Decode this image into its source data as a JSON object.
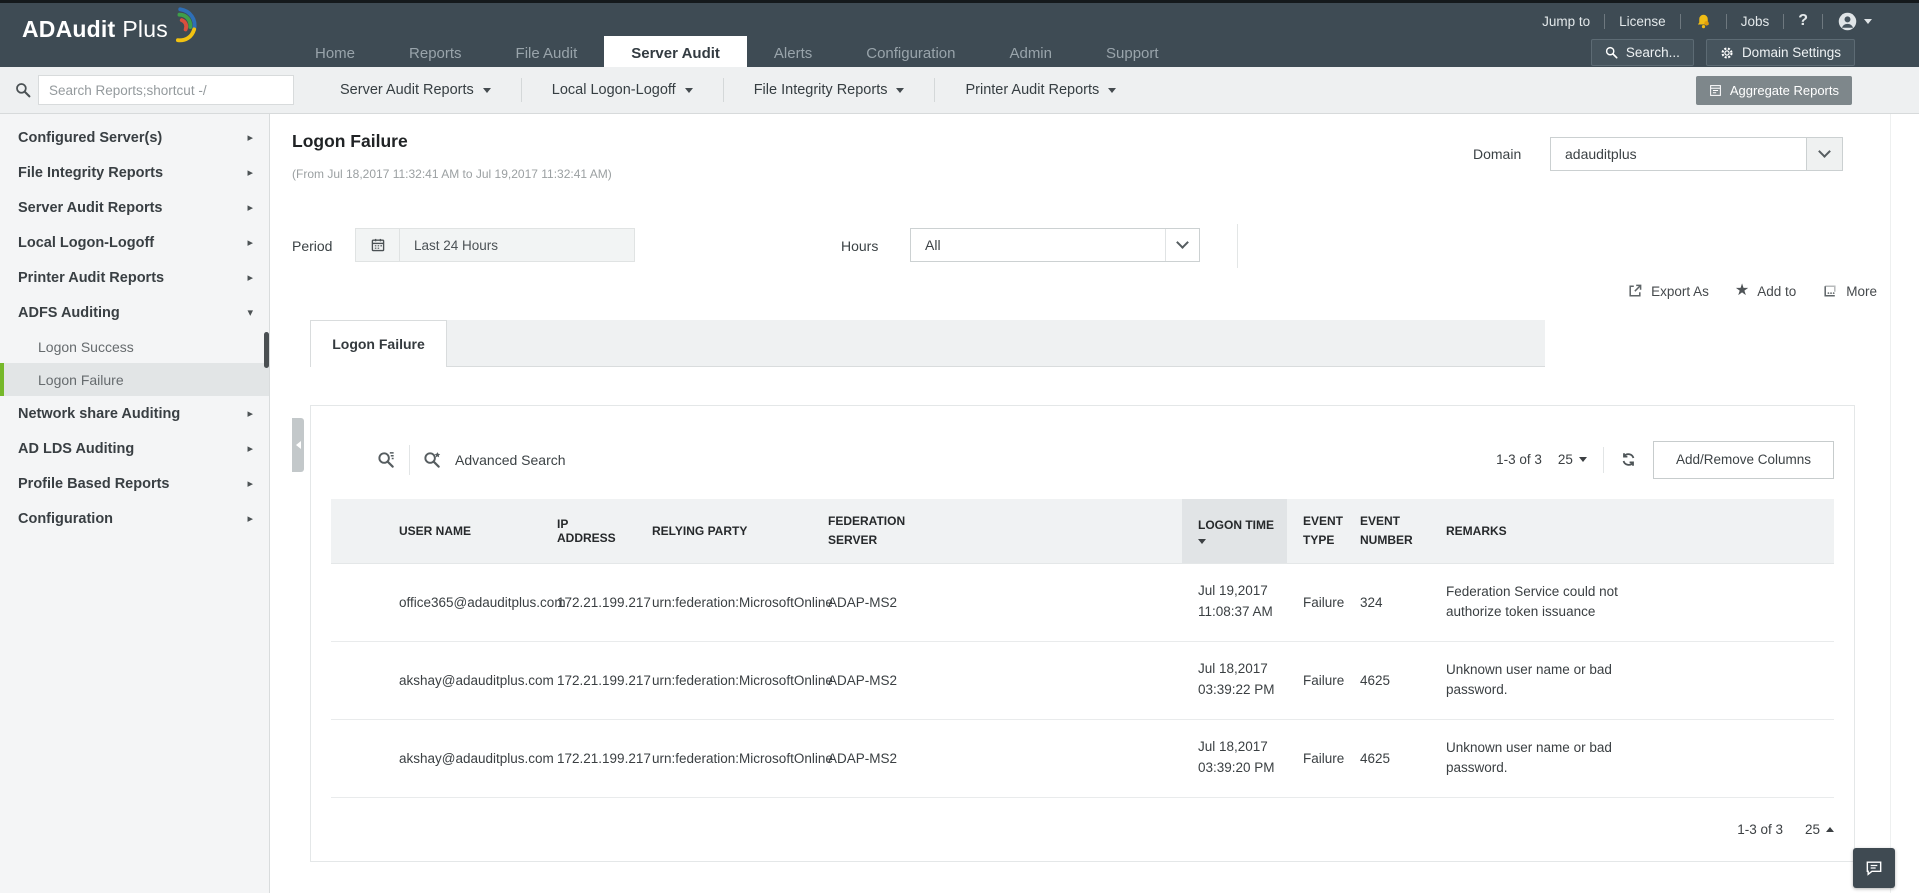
{
  "theme": {
    "topbar_bg": "#3e4b54",
    "accent_green": "#76b82a",
    "bell_yellow": "#f0bc15",
    "selected_row_bg": "#e2e5e6"
  },
  "brand": {
    "name_primary": "ADAudit",
    "name_secondary": "Plus"
  },
  "topbar": {
    "utility": {
      "jump_to": "Jump to",
      "license": "License",
      "jobs": "Jobs",
      "help": "?"
    },
    "nav": [
      {
        "label": "Home"
      },
      {
        "label": "Reports"
      },
      {
        "label": "File Audit"
      },
      {
        "label": "Server Audit",
        "active": true
      },
      {
        "label": "Alerts"
      },
      {
        "label": "Configuration"
      },
      {
        "label": "Admin"
      },
      {
        "label": "Support"
      }
    ],
    "search_button": "Search...",
    "domain_settings_button": "Domain Settings"
  },
  "subnav": {
    "search_placeholder": "Search Reports;shortcut -/",
    "menus": [
      {
        "label": "Server Audit Reports"
      },
      {
        "label": "Local Logon-Logoff"
      },
      {
        "label": "File Integrity Reports"
      },
      {
        "label": "Printer Audit Reports"
      }
    ],
    "aggregate_button": "Aggregate Reports"
  },
  "sidebar": {
    "items": [
      {
        "label": "Configured Server(s)",
        "arrow": "▸",
        "level": 0
      },
      {
        "label": "File Integrity Reports",
        "arrow": "▸",
        "level": 0
      },
      {
        "label": "Server Audit Reports",
        "arrow": "▸",
        "level": 0
      },
      {
        "label": "Local Logon-Logoff",
        "arrow": "▸",
        "level": 0
      },
      {
        "label": "Printer Audit Reports",
        "arrow": "▸",
        "level": 0
      },
      {
        "label": "ADFS Auditing",
        "arrow": "▾",
        "level": 0
      },
      {
        "label": "Logon Success",
        "arrow": "",
        "level": 1
      },
      {
        "label": "Logon Failure",
        "arrow": "",
        "level": 1,
        "selected": true
      },
      {
        "label": "Network share Auditing",
        "arrow": "▸",
        "level": 0
      },
      {
        "label": "AD LDS Auditing",
        "arrow": "▸",
        "level": 0
      },
      {
        "label": "Profile Based Reports",
        "arrow": "▸",
        "level": 0
      },
      {
        "label": "Configuration",
        "arrow": "▸",
        "level": 0
      }
    ]
  },
  "report": {
    "title": "Logon Failure",
    "subtitle": "(From Jul 18,2017 11:32:41 AM to Jul 19,2017 11:32:41 AM)",
    "domain": {
      "label": "Domain",
      "value": "adauditplus"
    },
    "period": {
      "label": "Period",
      "value": "Last 24 Hours"
    },
    "hours": {
      "label": "Hours",
      "value": "All"
    },
    "actions": {
      "export_as": "Export As",
      "add_to": "Add to",
      "more": "More"
    },
    "tab": "Logon Failure"
  },
  "table": {
    "advanced_search": "Advanced Search",
    "pagination": "1-3 of 3",
    "page_size": "25",
    "add_remove_columns": "Add/Remove Columns",
    "columns": [
      "USER NAME",
      "IP ADDRESS",
      "RELYING PARTY",
      "FEDERATION SERVER",
      "LOGON TIME",
      "EVENT TYPE",
      "EVENT NUMBER",
      "REMARKS"
    ],
    "rows": [
      {
        "user": "office365@adauditplus.com",
        "ip": "172.21.199.217",
        "relying_party": "urn:federation:MicrosoftOnline",
        "federation_server": "ADAP-MS2",
        "logon_date": "Jul 19,2017",
        "logon_time": "11:08:37 AM",
        "event_type": "Failure",
        "event_number": "324",
        "remarks": "Federation Service could not authorize token issuance"
      },
      {
        "user": "akshay@adauditplus.com",
        "ip": "172.21.199.217",
        "relying_party": "urn:federation:MicrosoftOnline",
        "federation_server": "ADAP-MS2",
        "logon_date": "Jul 18,2017",
        "logon_time": "03:39:22 PM",
        "event_type": "Failure",
        "event_number": "4625",
        "remarks": "Unknown user name or bad password."
      },
      {
        "user": "akshay@adauditplus.com",
        "ip": "172.21.199.217",
        "relying_party": "urn:federation:MicrosoftOnline",
        "federation_server": "ADAP-MS2",
        "logon_date": "Jul 18,2017",
        "logon_time": "03:39:20 PM",
        "event_type": "Failure",
        "event_number": "4625",
        "remarks": "Unknown user name or bad password."
      }
    ],
    "footer": {
      "pagination": "1-3 of 3",
      "page_size": "25"
    }
  }
}
